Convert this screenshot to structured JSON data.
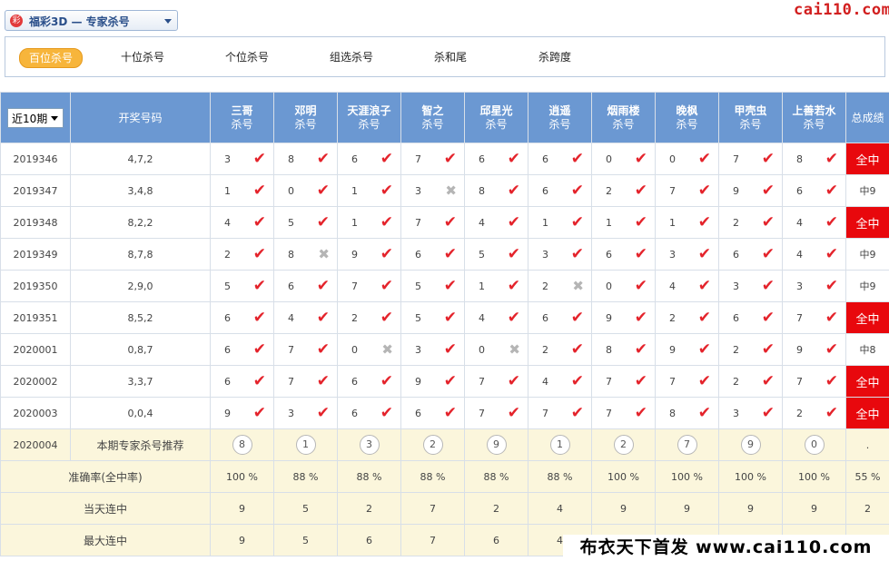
{
  "header": {
    "logo_text": "彩",
    "title": "福彩3D — 专家杀号",
    "site": "cai110.com"
  },
  "tabs": [
    "百位杀号",
    "十位杀号",
    "个位杀号",
    "组选杀号",
    "杀和尾",
    "杀跨度"
  ],
  "active_tab": 0,
  "table": {
    "period_select": "近10期",
    "col_draw": "开奖号码",
    "col_total": "总成绩",
    "kill_suffix": "杀号",
    "experts": [
      "三哥",
      "邓明",
      "天涯浪子",
      "智之",
      "邱星光",
      "逍遥",
      "烟雨楼",
      "晚枫",
      "甲壳虫",
      "上善若水"
    ],
    "rows": [
      {
        "issue": "2019346",
        "draw": "4,7,2",
        "kills": [
          [
            3,
            1
          ],
          [
            8,
            1
          ],
          [
            6,
            1
          ],
          [
            7,
            1
          ],
          [
            6,
            1
          ],
          [
            6,
            1
          ],
          [
            0,
            1
          ],
          [
            0,
            1
          ],
          [
            7,
            1
          ],
          [
            8,
            1
          ]
        ],
        "total": "全中"
      },
      {
        "issue": "2019347",
        "draw": "3,4,8",
        "kills": [
          [
            1,
            1
          ],
          [
            0,
            1
          ],
          [
            1,
            1
          ],
          [
            3,
            0
          ],
          [
            8,
            1
          ],
          [
            6,
            1
          ],
          [
            2,
            1
          ],
          [
            7,
            1
          ],
          [
            9,
            1
          ],
          [
            6,
            1
          ]
        ],
        "total": "中9"
      },
      {
        "issue": "2019348",
        "draw": "8,2,2",
        "kills": [
          [
            4,
            1
          ],
          [
            5,
            1
          ],
          [
            1,
            1
          ],
          [
            7,
            1
          ],
          [
            4,
            1
          ],
          [
            1,
            1
          ],
          [
            1,
            1
          ],
          [
            1,
            1
          ],
          [
            2,
            1
          ],
          [
            4,
            1
          ]
        ],
        "total": "全中"
      },
      {
        "issue": "2019349",
        "draw": "8,7,8",
        "kills": [
          [
            2,
            1
          ],
          [
            8,
            0
          ],
          [
            9,
            1
          ],
          [
            6,
            1
          ],
          [
            5,
            1
          ],
          [
            3,
            1
          ],
          [
            6,
            1
          ],
          [
            3,
            1
          ],
          [
            6,
            1
          ],
          [
            4,
            1
          ]
        ],
        "total": "中9"
      },
      {
        "issue": "2019350",
        "draw": "2,9,0",
        "kills": [
          [
            5,
            1
          ],
          [
            6,
            1
          ],
          [
            7,
            1
          ],
          [
            5,
            1
          ],
          [
            1,
            1
          ],
          [
            2,
            0
          ],
          [
            0,
            1
          ],
          [
            4,
            1
          ],
          [
            3,
            1
          ],
          [
            3,
            1
          ]
        ],
        "total": "中9"
      },
      {
        "issue": "2019351",
        "draw": "8,5,2",
        "kills": [
          [
            6,
            1
          ],
          [
            4,
            1
          ],
          [
            2,
            1
          ],
          [
            5,
            1
          ],
          [
            4,
            1
          ],
          [
            6,
            1
          ],
          [
            9,
            1
          ],
          [
            2,
            1
          ],
          [
            6,
            1
          ],
          [
            7,
            1
          ]
        ],
        "total": "全中"
      },
      {
        "issue": "2020001",
        "draw": "0,8,7",
        "kills": [
          [
            6,
            1
          ],
          [
            7,
            1
          ],
          [
            0,
            0
          ],
          [
            3,
            1
          ],
          [
            0,
            0
          ],
          [
            2,
            1
          ],
          [
            8,
            1
          ],
          [
            9,
            1
          ],
          [
            2,
            1
          ],
          [
            9,
            1
          ]
        ],
        "total": "中8"
      },
      {
        "issue": "2020002",
        "draw": "3,3,7",
        "kills": [
          [
            6,
            1
          ],
          [
            7,
            1
          ],
          [
            6,
            1
          ],
          [
            9,
            1
          ],
          [
            7,
            1
          ],
          [
            4,
            1
          ],
          [
            7,
            1
          ],
          [
            7,
            1
          ],
          [
            2,
            1
          ],
          [
            7,
            1
          ]
        ],
        "total": "全中"
      },
      {
        "issue": "2020003",
        "draw": "0,0,4",
        "kills": [
          [
            9,
            1
          ],
          [
            3,
            1
          ],
          [
            6,
            1
          ],
          [
            6,
            1
          ],
          [
            7,
            1
          ],
          [
            7,
            1
          ],
          [
            7,
            1
          ],
          [
            8,
            1
          ],
          [
            3,
            1
          ],
          [
            2,
            1
          ]
        ],
        "total": "全中"
      }
    ],
    "recommend": {
      "issue": "2020004",
      "label": "本期专家杀号推荐",
      "numbers": [
        "8",
        "1",
        "3",
        "2",
        "9",
        "1",
        "2",
        "7",
        "9",
        "0"
      ],
      "total": "."
    },
    "stats": [
      {
        "label": "准确率(全中率)",
        "values": [
          "100 %",
          "88 %",
          "88 %",
          "88 %",
          "88 %",
          "88 %",
          "100 %",
          "100 %",
          "100 %",
          "100 %"
        ],
        "total": "55 %"
      },
      {
        "label": "当天连中",
        "values": [
          "9",
          "5",
          "2",
          "7",
          "2",
          "4",
          "9",
          "9",
          "9",
          "9"
        ],
        "total": "2"
      },
      {
        "label": "最大连中",
        "values": [
          "9",
          "5",
          "6",
          "7",
          "6",
          "4",
          "",
          "",
          "",
          ""
        ],
        "total": ""
      }
    ]
  },
  "footer_watermark": "布衣天下首发 www.cai110.com",
  "colors": {
    "header_blue": "#6b98d2",
    "hit_red": "#e4232b",
    "full_hit_bg": "#e8080d",
    "recommend_bg": "#fbf6dc",
    "tab_active": "#f7b53b"
  }
}
